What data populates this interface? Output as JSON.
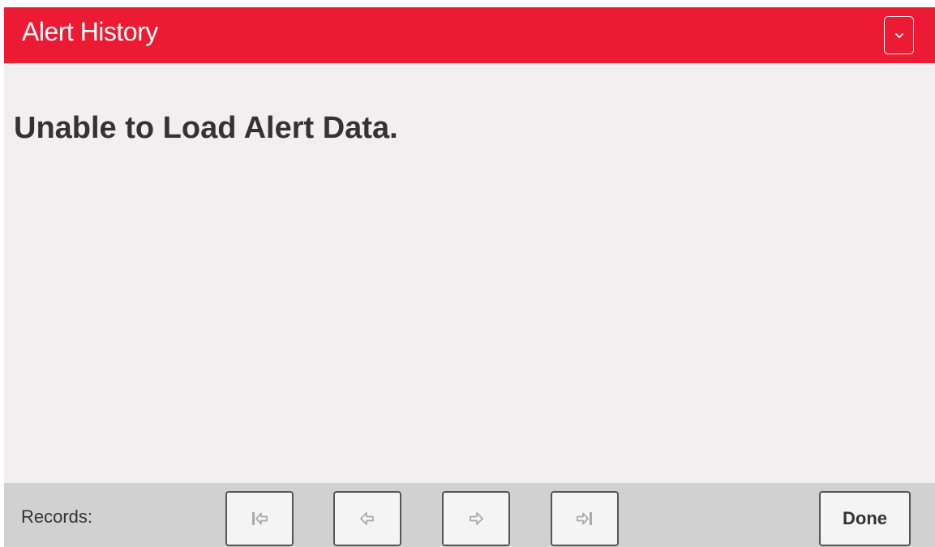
{
  "header": {
    "title": "Alert History",
    "menu_icon": "chevron-down-icon"
  },
  "content": {
    "error_message": "Unable to Load Alert Data."
  },
  "footer": {
    "records_label": "Records:",
    "nav_buttons": [
      {
        "name": "first",
        "icon": "first-record-icon"
      },
      {
        "name": "previous",
        "icon": "previous-record-icon"
      },
      {
        "name": "next",
        "icon": "next-record-icon"
      },
      {
        "name": "last",
        "icon": "last-record-icon"
      }
    ],
    "done_label": "Done"
  },
  "colors": {
    "header_bg": "#ed1a33",
    "content_bg": "#f1eff0",
    "footer_bg": "#d2d1d1",
    "text": "#333333",
    "icon_gray": "#aaaaaa"
  }
}
